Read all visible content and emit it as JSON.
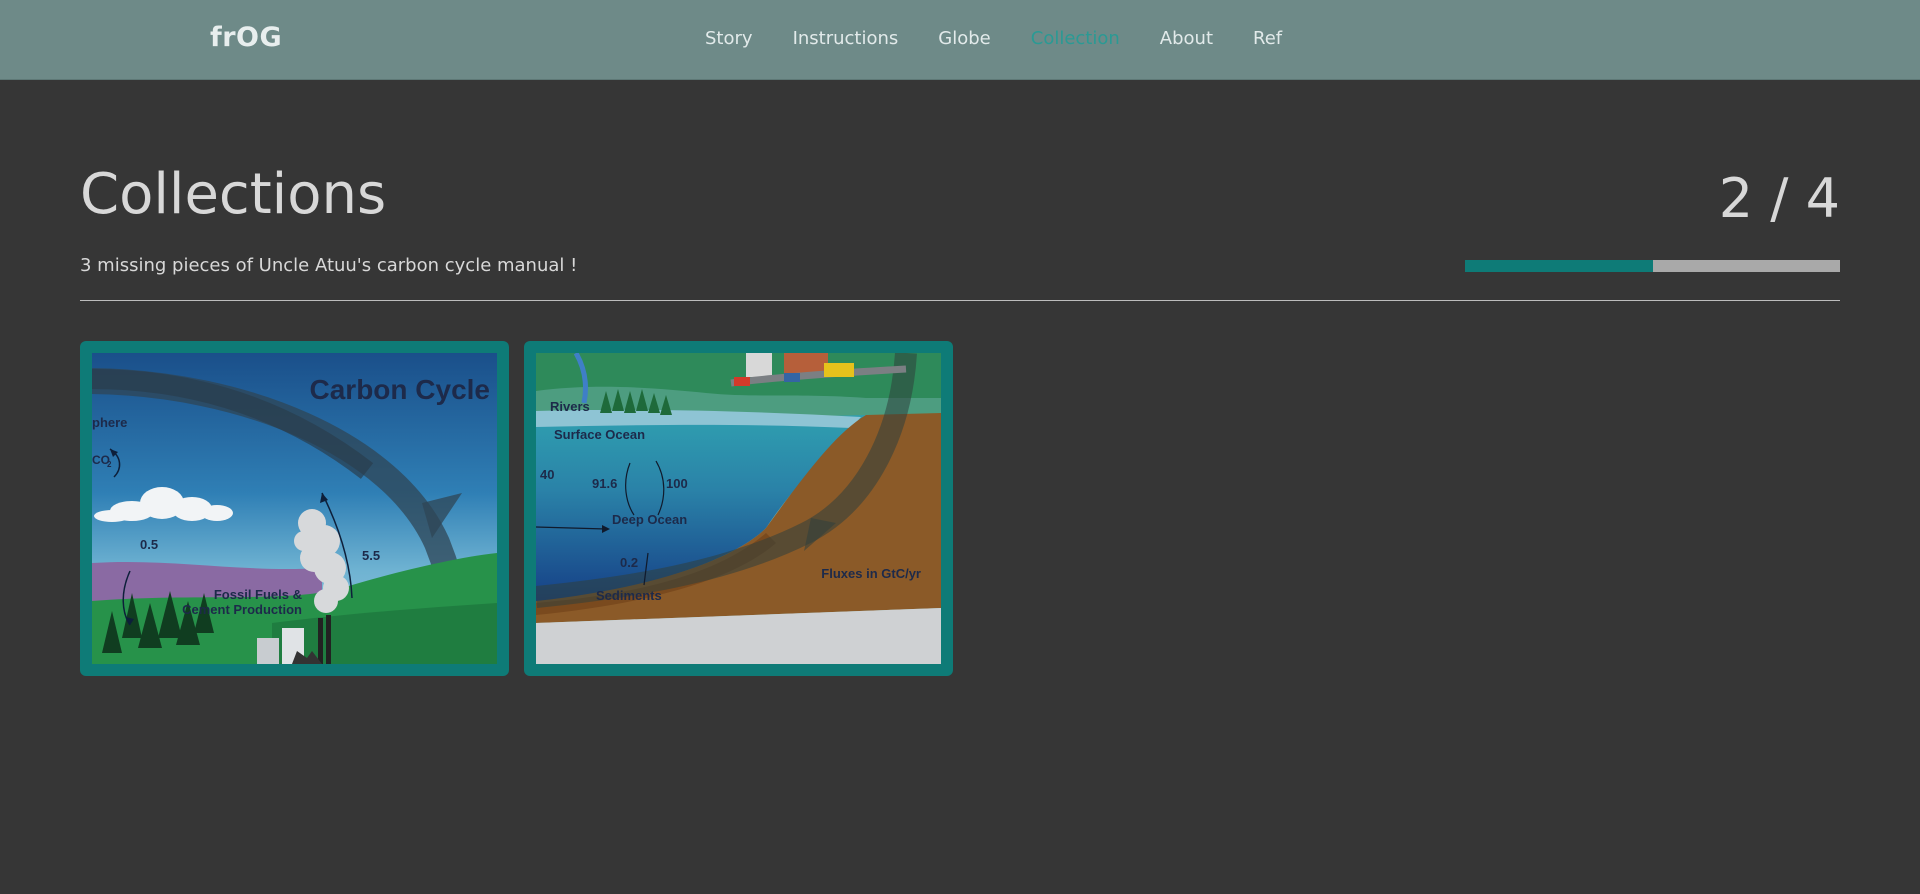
{
  "nav": {
    "brand": "frOG",
    "links": [
      {
        "label": "Story",
        "active": false
      },
      {
        "label": "Instructions",
        "active": false
      },
      {
        "label": "Globe",
        "active": false
      },
      {
        "label": "Collection",
        "active": true
      },
      {
        "label": "About",
        "active": false
      },
      {
        "label": "Ref",
        "active": false
      }
    ]
  },
  "page": {
    "title": "Collections",
    "counter": "2 / 4",
    "subtitle": "3 missing pieces of Uncle Atuu's carbon cycle manual !",
    "progress_fraction": 0.5
  },
  "colors": {
    "navbar_bg": "#6e8a88",
    "page_bg": "#363636",
    "accent": "#0e7b77",
    "active_link": "#2a9a94",
    "progress_track": "#a9a9a9"
  },
  "cards": [
    {
      "title": "Carbon Cycle",
      "labels": {
        "atmosphere": "phere",
        "co2": "CO",
        "co2_sub": "2",
        "flux_a": "0.5",
        "flux_b": "5.5",
        "fossil_1": "Fossil Fuels &",
        "fossil_2": "Cement Production"
      }
    },
    {
      "labels": {
        "rivers": "Rivers",
        "surface": "Surface Ocean",
        "flux_40": "40",
        "flux_916": "91.6",
        "flux_100": "100",
        "deep": "Deep Ocean",
        "flux_02": "0.2",
        "sediments": "Sediments",
        "units": "Fluxes in GtC/yr"
      }
    }
  ]
}
